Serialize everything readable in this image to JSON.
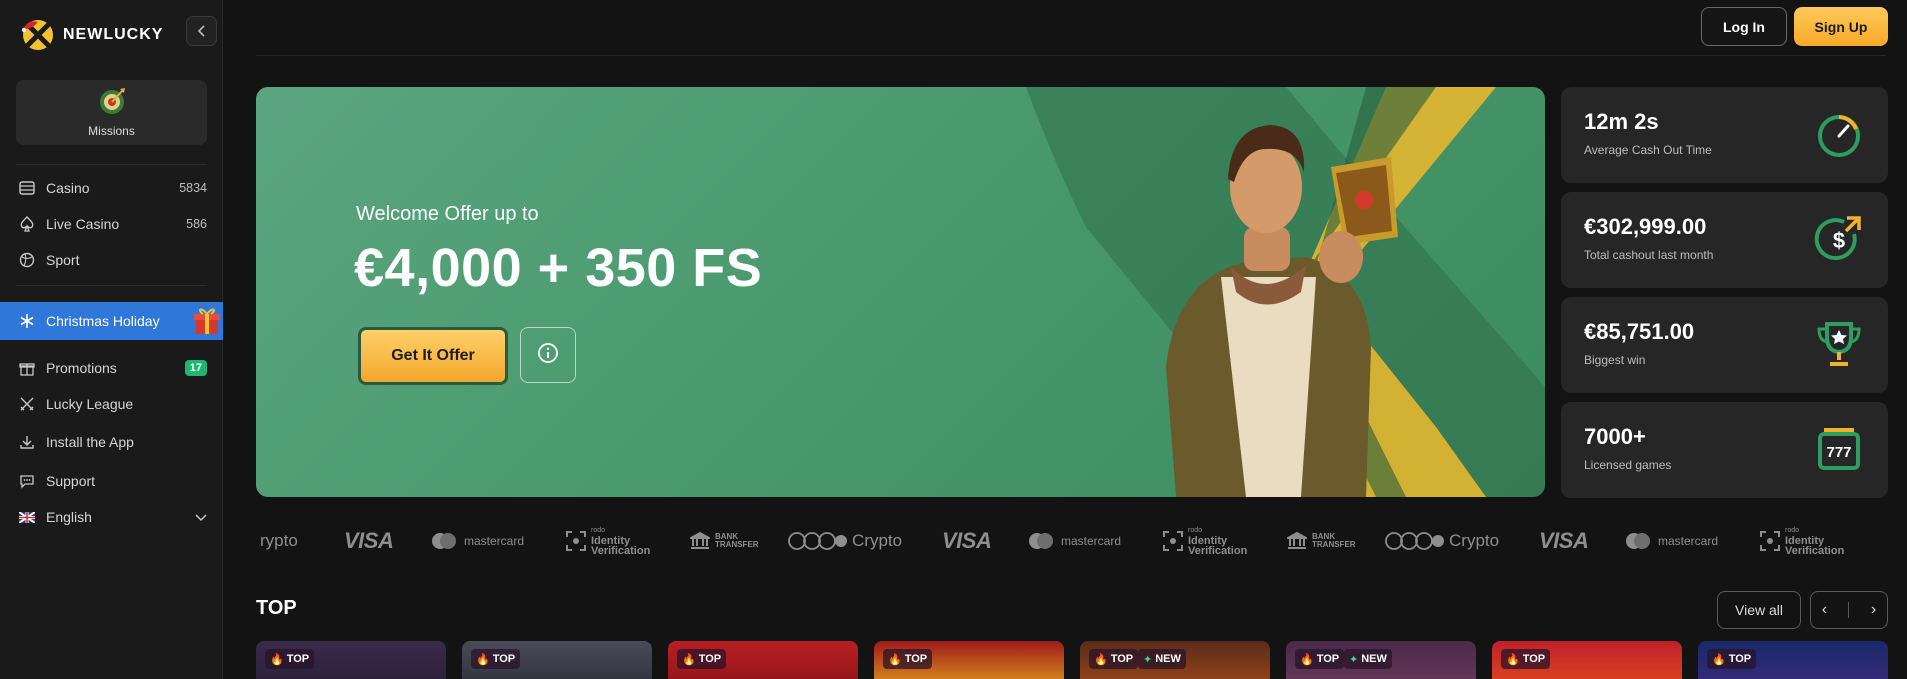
{
  "brand": {
    "name": "NEWLUCKY"
  },
  "sidebar": {
    "missions_label": "Missions",
    "items": [
      {
        "label": "Casino",
        "count": "5834",
        "icon": "casino-icon"
      },
      {
        "label": "Live Casino",
        "count": "586",
        "icon": "spade-icon"
      },
      {
        "label": "Sport",
        "icon": "ball-icon"
      },
      {
        "label": "Christmas Holiday",
        "icon": "snowflake-icon",
        "active": true
      },
      {
        "label": "Promotions",
        "badge": "17",
        "icon": "gift-icon"
      },
      {
        "label": "Lucky League",
        "icon": "swords-icon"
      },
      {
        "label": "Install the App",
        "icon": "download-icon"
      },
      {
        "label": "Support",
        "icon": "chat-icon"
      },
      {
        "label": "English",
        "icon": "flag-icon"
      }
    ]
  },
  "header": {
    "login_label": "Log In",
    "signup_label": "Sign Up"
  },
  "hero": {
    "subtitle": "Welcome Offer up to",
    "title": "€4,000 + 350 FS",
    "cta_label": "Get It Offer"
  },
  "stats": [
    {
      "value": "12m 2s",
      "label": "Average Cash Out Time",
      "icon": "stopwatch-icon"
    },
    {
      "value": "€302,999.00",
      "label": "Total cashout last month",
      "icon": "dollar-coin-icon"
    },
    {
      "value": "€85,751.00",
      "label": "Biggest win",
      "icon": "trophy-icon"
    },
    {
      "value": "7000+",
      "label": "Licensed games",
      "icon": "slot-777-icon"
    }
  ],
  "payments": {
    "crypto_partial": "rypto",
    "visa": "VISA",
    "mastercard": "mastercard",
    "idv_small": "rodo",
    "idv_1": "Identity",
    "idv_2": "Verification",
    "bank_1": "BANK",
    "bank_2": "TRANSFER",
    "crypto": "Crypto"
  },
  "top_section": {
    "title": "TOP",
    "view_all_label": "View all",
    "prev_label": "‹",
    "next_label": "›",
    "tag_top": "TOP",
    "tag_new": "NEW"
  },
  "colors": {
    "accent": "#2f77d8",
    "cta": "#f7a928",
    "hero_green": "#4a9a6e",
    "badge_green": "#1db772"
  }
}
